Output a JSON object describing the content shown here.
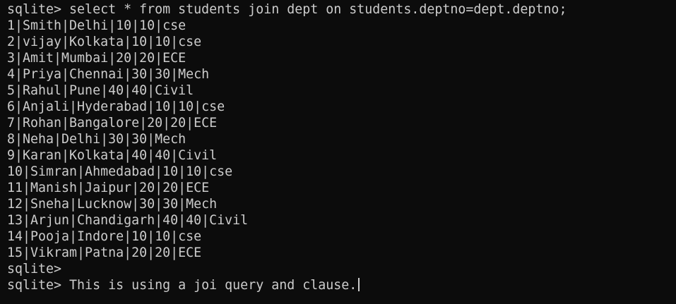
{
  "terminal": {
    "background": "#0c0c0c",
    "foreground": "#cccccc",
    "query_line": "sqlite> select * from students join dept on students.deptno=dept.deptno;",
    "rows": [
      "1|Smith|Delhi|10|10|cse",
      "2|vijay|Kolkata|10|10|cse",
      "3|Amit|Mumbai|20|20|ECE",
      "4|Priya|Chennai|30|30|Mech",
      "5|Rahul|Pune|40|40|Civil",
      "6|Anjali|Hyderabad|10|10|cse",
      "7|Rohan|Bangalore|20|20|ECE",
      "8|Neha|Delhi|30|30|Mech",
      "9|Karan|Kolkata|40|40|Civil",
      "10|Simran|Ahmedabad|10|10|cse",
      "11|Manish|Jaipur|20|20|ECE",
      "12|Sneha|Lucknow|30|30|Mech",
      "13|Arjun|Chandigarh|40|40|Civil",
      "14|Pooja|Indore|10|10|cse",
      "15|Vikram|Patna|20|20|ECE"
    ],
    "empty_prompt": "sqlite>",
    "input_line": "sqlite> This is using a joi query and clause."
  }
}
